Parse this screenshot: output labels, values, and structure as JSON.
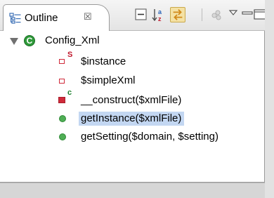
{
  "view": {
    "tab_label": "Outline",
    "tab_close_glyph": "☒"
  },
  "toolbar": {
    "buttons": [
      {
        "name": "collapse-all-icon"
      },
      {
        "name": "sort-alpha-icon"
      },
      {
        "name": "link-with-editor-icon"
      },
      {
        "name": "filter-icon"
      },
      {
        "name": "view-menu-icon"
      },
      {
        "name": "minimize-icon"
      },
      {
        "name": "maximize-icon"
      }
    ]
  },
  "tree": {
    "class": {
      "name": "Config_Xml",
      "icon": "class-icon",
      "badge": "C"
    },
    "members": [
      {
        "label": "$instance",
        "icon": "private-field-icon",
        "modifier": "S",
        "modifier_color": "#c0162b"
      },
      {
        "label": "$simpleXml",
        "icon": "private-field-icon"
      },
      {
        "label": "__construct($xmlFile)",
        "icon": "private-method-icon",
        "modifier": "c",
        "modifier_color": "#1b7f2c"
      },
      {
        "label": "getInstance($xmlFile)",
        "icon": "public-method-icon",
        "selected": true
      },
      {
        "label": "getSetting($domain, $setting)",
        "icon": "public-method-icon"
      }
    ]
  },
  "colors": {
    "selection": "#c3d7f2",
    "class_green": "#2f9a3a",
    "private_red": "#d02a3a",
    "public_green": "#4fae55"
  }
}
